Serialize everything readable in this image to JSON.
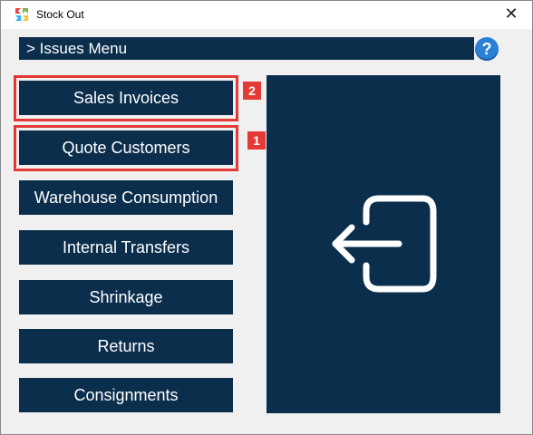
{
  "window": {
    "title": "Stock Out",
    "close_symbol": "✕"
  },
  "menu": {
    "title": "> Issues Menu",
    "help": "?"
  },
  "buttons": [
    {
      "label": "Sales Invoices"
    },
    {
      "label": "Quote Customers"
    },
    {
      "label": "Warehouse Consumption"
    },
    {
      "label": "Internal Transfers"
    },
    {
      "label": "Shrinkage"
    },
    {
      "label": "Returns"
    },
    {
      "label": "Consignments"
    }
  ],
  "annotations": [
    {
      "number": "2",
      "target": "Sales Invoices"
    },
    {
      "number": "1",
      "target": "Quote Customers"
    }
  ],
  "panel": {
    "icon": "exit-arrow-icon"
  }
}
